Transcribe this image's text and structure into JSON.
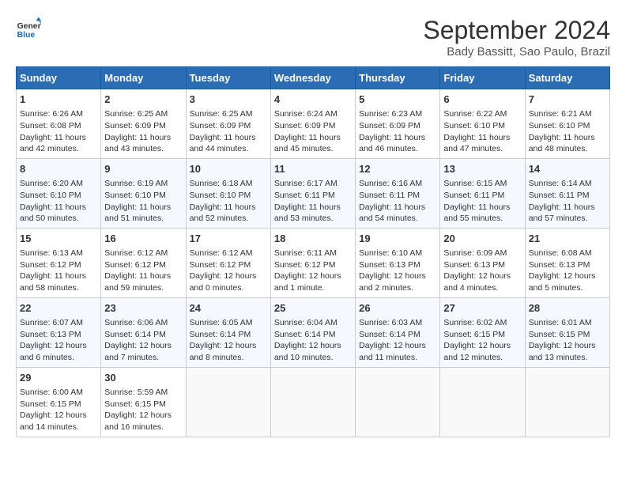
{
  "header": {
    "logo_line1": "General",
    "logo_line2": "Blue",
    "title": "September 2024",
    "subtitle": "Bady Bassitt, Sao Paulo, Brazil"
  },
  "weekdays": [
    "Sunday",
    "Monday",
    "Tuesday",
    "Wednesday",
    "Thursday",
    "Friday",
    "Saturday"
  ],
  "weeks": [
    [
      {
        "day": "1",
        "lines": [
          "Sunrise: 6:26 AM",
          "Sunset: 6:08 PM",
          "Daylight: 11 hours",
          "and 42 minutes."
        ]
      },
      {
        "day": "2",
        "lines": [
          "Sunrise: 6:25 AM",
          "Sunset: 6:09 PM",
          "Daylight: 11 hours",
          "and 43 minutes."
        ]
      },
      {
        "day": "3",
        "lines": [
          "Sunrise: 6:25 AM",
          "Sunset: 6:09 PM",
          "Daylight: 11 hours",
          "and 44 minutes."
        ]
      },
      {
        "day": "4",
        "lines": [
          "Sunrise: 6:24 AM",
          "Sunset: 6:09 PM",
          "Daylight: 11 hours",
          "and 45 minutes."
        ]
      },
      {
        "day": "5",
        "lines": [
          "Sunrise: 6:23 AM",
          "Sunset: 6:09 PM",
          "Daylight: 11 hours",
          "and 46 minutes."
        ]
      },
      {
        "day": "6",
        "lines": [
          "Sunrise: 6:22 AM",
          "Sunset: 6:10 PM",
          "Daylight: 11 hours",
          "and 47 minutes."
        ]
      },
      {
        "day": "7",
        "lines": [
          "Sunrise: 6:21 AM",
          "Sunset: 6:10 PM",
          "Daylight: 11 hours",
          "and 48 minutes."
        ]
      }
    ],
    [
      {
        "day": "8",
        "lines": [
          "Sunrise: 6:20 AM",
          "Sunset: 6:10 PM",
          "Daylight: 11 hours",
          "and 50 minutes."
        ]
      },
      {
        "day": "9",
        "lines": [
          "Sunrise: 6:19 AM",
          "Sunset: 6:10 PM",
          "Daylight: 11 hours",
          "and 51 minutes."
        ]
      },
      {
        "day": "10",
        "lines": [
          "Sunrise: 6:18 AM",
          "Sunset: 6:10 PM",
          "Daylight: 11 hours",
          "and 52 minutes."
        ]
      },
      {
        "day": "11",
        "lines": [
          "Sunrise: 6:17 AM",
          "Sunset: 6:11 PM",
          "Daylight: 11 hours",
          "and 53 minutes."
        ]
      },
      {
        "day": "12",
        "lines": [
          "Sunrise: 6:16 AM",
          "Sunset: 6:11 PM",
          "Daylight: 11 hours",
          "and 54 minutes."
        ]
      },
      {
        "day": "13",
        "lines": [
          "Sunrise: 6:15 AM",
          "Sunset: 6:11 PM",
          "Daylight: 11 hours",
          "and 55 minutes."
        ]
      },
      {
        "day": "14",
        "lines": [
          "Sunrise: 6:14 AM",
          "Sunset: 6:11 PM",
          "Daylight: 11 hours",
          "and 57 minutes."
        ]
      }
    ],
    [
      {
        "day": "15",
        "lines": [
          "Sunrise: 6:13 AM",
          "Sunset: 6:12 PM",
          "Daylight: 11 hours",
          "and 58 minutes."
        ]
      },
      {
        "day": "16",
        "lines": [
          "Sunrise: 6:12 AM",
          "Sunset: 6:12 PM",
          "Daylight: 11 hours",
          "and 59 minutes."
        ]
      },
      {
        "day": "17",
        "lines": [
          "Sunrise: 6:12 AM",
          "Sunset: 6:12 PM",
          "Daylight: 12 hours",
          "and 0 minutes."
        ]
      },
      {
        "day": "18",
        "lines": [
          "Sunrise: 6:11 AM",
          "Sunset: 6:12 PM",
          "Daylight: 12 hours",
          "and 1 minute."
        ]
      },
      {
        "day": "19",
        "lines": [
          "Sunrise: 6:10 AM",
          "Sunset: 6:13 PM",
          "Daylight: 12 hours",
          "and 2 minutes."
        ]
      },
      {
        "day": "20",
        "lines": [
          "Sunrise: 6:09 AM",
          "Sunset: 6:13 PM",
          "Daylight: 12 hours",
          "and 4 minutes."
        ]
      },
      {
        "day": "21",
        "lines": [
          "Sunrise: 6:08 AM",
          "Sunset: 6:13 PM",
          "Daylight: 12 hours",
          "and 5 minutes."
        ]
      }
    ],
    [
      {
        "day": "22",
        "lines": [
          "Sunrise: 6:07 AM",
          "Sunset: 6:13 PM",
          "Daylight: 12 hours",
          "and 6 minutes."
        ]
      },
      {
        "day": "23",
        "lines": [
          "Sunrise: 6:06 AM",
          "Sunset: 6:14 PM",
          "Daylight: 12 hours",
          "and 7 minutes."
        ]
      },
      {
        "day": "24",
        "lines": [
          "Sunrise: 6:05 AM",
          "Sunset: 6:14 PM",
          "Daylight: 12 hours",
          "and 8 minutes."
        ]
      },
      {
        "day": "25",
        "lines": [
          "Sunrise: 6:04 AM",
          "Sunset: 6:14 PM",
          "Daylight: 12 hours",
          "and 10 minutes."
        ]
      },
      {
        "day": "26",
        "lines": [
          "Sunrise: 6:03 AM",
          "Sunset: 6:14 PM",
          "Daylight: 12 hours",
          "and 11 minutes."
        ]
      },
      {
        "day": "27",
        "lines": [
          "Sunrise: 6:02 AM",
          "Sunset: 6:15 PM",
          "Daylight: 12 hours",
          "and 12 minutes."
        ]
      },
      {
        "day": "28",
        "lines": [
          "Sunrise: 6:01 AM",
          "Sunset: 6:15 PM",
          "Daylight: 12 hours",
          "and 13 minutes."
        ]
      }
    ],
    [
      {
        "day": "29",
        "lines": [
          "Sunrise: 6:00 AM",
          "Sunset: 6:15 PM",
          "Daylight: 12 hours",
          "and 14 minutes."
        ]
      },
      {
        "day": "30",
        "lines": [
          "Sunrise: 5:59 AM",
          "Sunset: 6:15 PM",
          "Daylight: 12 hours",
          "and 16 minutes."
        ]
      },
      {
        "day": "",
        "lines": []
      },
      {
        "day": "",
        "lines": []
      },
      {
        "day": "",
        "lines": []
      },
      {
        "day": "",
        "lines": []
      },
      {
        "day": "",
        "lines": []
      }
    ]
  ]
}
